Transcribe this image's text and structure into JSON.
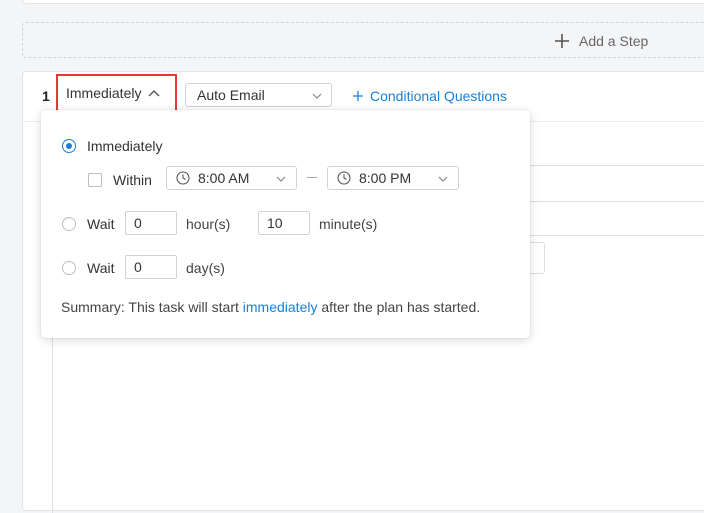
{
  "add_step": {
    "label": "Add a Step"
  },
  "step": {
    "number": "1",
    "trigger_label": "Immediately",
    "action_select": "Auto Email",
    "conditional_label": "Conditional Questions"
  },
  "popover": {
    "option_immediately": "Immediately",
    "within_label": "Within",
    "within_start": "8:00 AM",
    "within_end": "8:00 PM",
    "wait_label": "Wait",
    "wait_hours_value": "0",
    "hours_unit": "hour(s)",
    "wait_minutes_value": "10",
    "minutes_unit": "minute(s)",
    "wait_days_value": "0",
    "days_unit": "day(s)",
    "summary_prefix": "Summary: This task will start ",
    "summary_highlight": "immediately",
    "summary_suffix": " after the plan has started."
  },
  "colors": {
    "accent": "#1a7fd6",
    "highlight_border": "#e53935"
  },
  "icons": {
    "add_step": "plus-icon",
    "trigger": "chevron-up-icon",
    "select": "chevron-down-icon",
    "time": "clock-icon"
  }
}
